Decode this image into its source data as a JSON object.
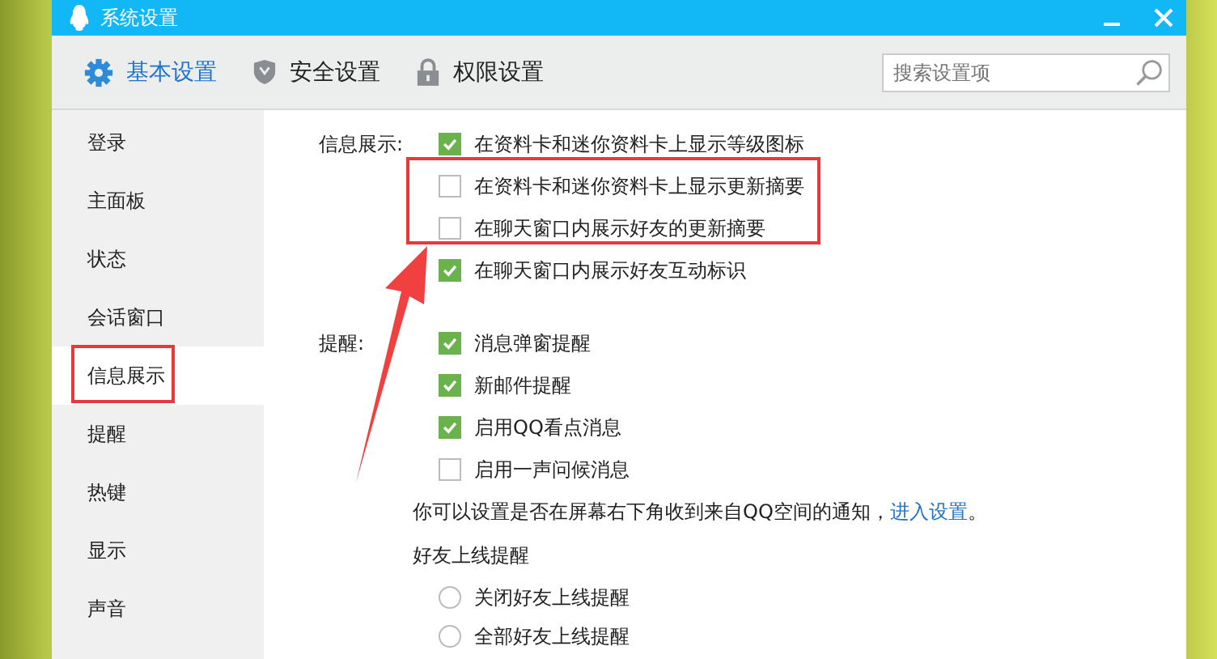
{
  "window": {
    "title": "系统设置"
  },
  "tabs": [
    {
      "label": "基本设置",
      "selected": true
    },
    {
      "label": "安全设置",
      "selected": false
    },
    {
      "label": "权限设置",
      "selected": false
    }
  ],
  "search": {
    "placeholder": "搜索设置项"
  },
  "sidebar": {
    "items": [
      {
        "label": "登录",
        "selected": false
      },
      {
        "label": "主面板",
        "selected": false
      },
      {
        "label": "状态",
        "selected": false
      },
      {
        "label": "会话窗口",
        "selected": false
      },
      {
        "label": "信息展示",
        "selected": true
      },
      {
        "label": "提醒",
        "selected": false
      },
      {
        "label": "热键",
        "selected": false
      },
      {
        "label": "显示",
        "selected": false
      },
      {
        "label": "声音",
        "selected": false
      }
    ]
  },
  "sections": [
    {
      "label": "信息展示:",
      "options": [
        {
          "label": "在资料卡和迷你资料卡上显示等级图标",
          "checked": true
        },
        {
          "label": "在资料卡和迷你资料卡上显示更新摘要",
          "checked": false
        },
        {
          "label": "在聊天窗口内展示好友的更新摘要",
          "checked": false
        },
        {
          "label": "在聊天窗口内展示好友互动标识",
          "checked": true
        }
      ]
    },
    {
      "label": "提醒:",
      "options": [
        {
          "label": "消息弹窗提醒",
          "checked": true
        },
        {
          "label": "新邮件提醒",
          "checked": true
        },
        {
          "label": "启用QQ看点消息",
          "checked": true
        },
        {
          "label": "启用一声问候消息",
          "checked": false
        }
      ]
    }
  ],
  "notice": {
    "text": "你可以设置是否在屏幕右下角收到来自QQ空间的通知，",
    "link": "进入设置",
    "end": "。"
  },
  "friend_online": {
    "title": "好友上线提醒",
    "options": [
      {
        "label": "关闭好友上线提醒",
        "selected": false
      },
      {
        "label": "全部好友上线提醒",
        "selected": false
      }
    ]
  }
}
